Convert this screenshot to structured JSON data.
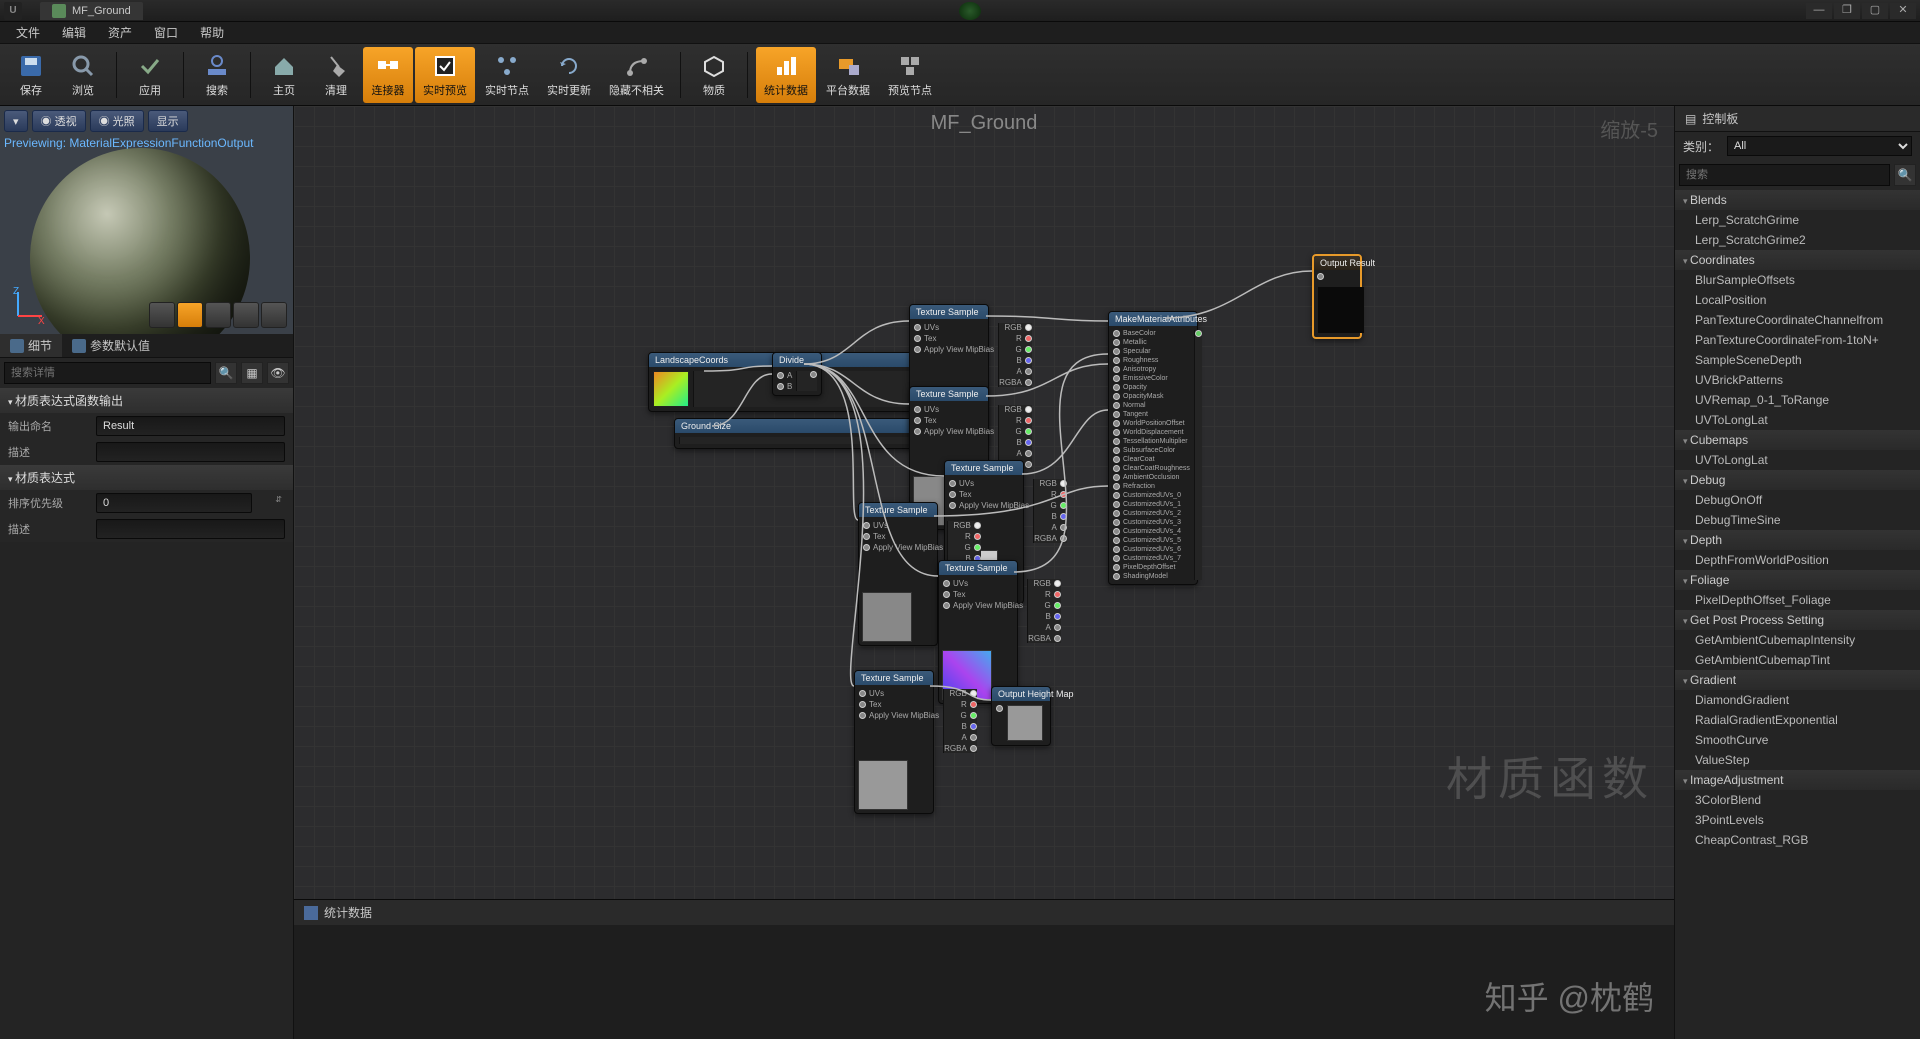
{
  "window": {
    "title": "MF_Ground"
  },
  "menu": {
    "file": "文件",
    "edit": "编辑",
    "asset": "资产",
    "window": "窗口",
    "help": "帮助"
  },
  "toolbar": {
    "save": "保存",
    "browse": "浏览",
    "apply": "应用",
    "search": "搜索",
    "home": "主页",
    "cleanup": "清理",
    "connectors": "连接器",
    "live_preview": "实时预览",
    "live_nodes": "实时节点",
    "live_update": "实时更新",
    "hide_unrelated": "隐藏不相关",
    "material": "物质",
    "stats": "统计数据",
    "platform_data": "平台数据",
    "preview_nodes": "预览节点"
  },
  "preview": {
    "perspective": "透视",
    "light": "光照",
    "show": "显示",
    "previewing_text": "Previewing: MaterialExpressionFunctionOutput"
  },
  "panels": {
    "details": "细节",
    "param_defaults": "参数默认值",
    "search_placeholder": "搜索详情"
  },
  "details": {
    "section1": "材质表达式函数输出",
    "output_name_label": "输出命名",
    "output_name_value": "Result",
    "description_label": "描述",
    "description_value": "",
    "section2": "材质表达式",
    "sort_priority_label": "排序优先级",
    "sort_priority_value": "0",
    "description2_label": "描述",
    "description2_value": ""
  },
  "graph": {
    "title": "MF_Ground",
    "zoom": "缩放-5",
    "watermark": "材质函数",
    "nodes": {
      "landscape": "LandscapeCoords",
      "divide": "Divide",
      "groundsize": "Ground Size",
      "texsample": "Texture Sample",
      "makeattr": "MakeMaterialAttributes",
      "outheight": "Output Height Map",
      "outresult": "Output Result",
      "pins": {
        "uvs": "UVs",
        "tex": "Tex",
        "applymip": "Apply View MipBias",
        "rgb": "RGB",
        "r": "R",
        "g": "G",
        "b": "B",
        "a": "A",
        "rgba": "RGBA"
      },
      "attr": {
        "basecolor": "BaseColor",
        "metallic": "Metallic",
        "specular": "Specular",
        "roughness": "Roughness",
        "anisotropy": "Anisotropy",
        "emissive": "EmissiveColor",
        "opacity": "Opacity",
        "opacitymask": "OpacityMask",
        "normal": "Normal",
        "tangent": "Tangent",
        "wpo": "WorldPositionOffset",
        "wdisplace": "WorldDisplacement",
        "tessmult": "TessellationMultiplier",
        "subsurface": "SubsurfaceColor",
        "clearcoat": "ClearCoat",
        "ccrough": "ClearCoatRoughness",
        "ao": "AmbientOcclusion",
        "refraction": "Refraction",
        "cuv0": "CustomizedUVs_0",
        "cuv1": "CustomizedUVs_1",
        "cuv2": "CustomizedUVs_2",
        "cuv3": "CustomizedUVs_3",
        "cuv4": "CustomizedUVs_4",
        "cuv5": "CustomizedUVs_5",
        "cuv6": "CustomizedUVs_6",
        "cuv7": "CustomizedUVs_7",
        "pdo": "PixelDepthOffset",
        "shadingmodel": "ShadingModel"
      }
    }
  },
  "stats_panel": {
    "title": "统计数据"
  },
  "palette": {
    "title": "控制板",
    "category_label": "类别：",
    "category_value": "All",
    "search_placeholder": "搜索",
    "categories": [
      {
        "name": "Blends",
        "items": [
          "Lerp_ScratchGrime",
          "Lerp_ScratchGrime2"
        ]
      },
      {
        "name": "Coordinates",
        "items": [
          "BlurSampleOffsets",
          "LocalPosition",
          "PanTextureCoordinateChannelfrom",
          "PanTextureCoordinateFrom-1toN+",
          "SampleSceneDepth",
          "UVBrickPatterns",
          "UVRemap_0-1_ToRange",
          "UVToLongLat"
        ]
      },
      {
        "name": "Cubemaps",
        "items": [
          "UVToLongLat"
        ]
      },
      {
        "name": "Debug",
        "items": [
          "DebugOnOff",
          "DebugTimeSine"
        ]
      },
      {
        "name": "Depth",
        "items": [
          "DepthFromWorldPosition"
        ]
      },
      {
        "name": "Foliage",
        "items": [
          "PixelDepthOffset_Foliage"
        ]
      },
      {
        "name": "Get Post Process Setting",
        "items": [
          "GetAmbientCubemapIntensity",
          "GetAmbientCubemapTint"
        ]
      },
      {
        "name": "Gradient",
        "items": [
          "DiamondGradient",
          "RadialGradientExponential",
          "SmoothCurve",
          "ValueStep"
        ]
      },
      {
        "name": "ImageAdjustment",
        "items": [
          "3ColorBlend",
          "3PointLevels",
          "CheapContrast_RGB"
        ]
      }
    ]
  },
  "attribution": "知乎 @枕鹤"
}
